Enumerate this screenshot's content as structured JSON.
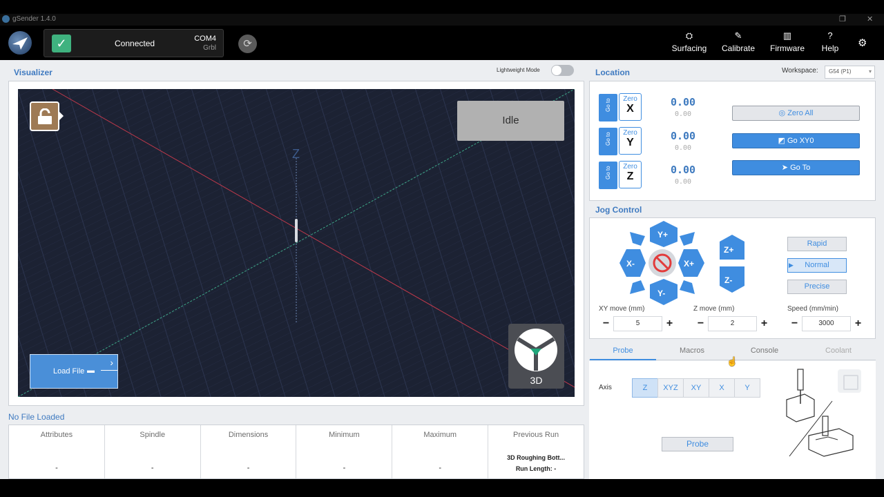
{
  "window": {
    "title": "gSender 1.4.0",
    "restore_glyph": "❐",
    "close_glyph": "✕"
  },
  "connection": {
    "status": "Connected",
    "port": "COM4",
    "firmware": "Grbl"
  },
  "nav": [
    {
      "label": "Surfacing",
      "icon": "surfacing-icon",
      "glyph": "⛭"
    },
    {
      "label": "Calibrate",
      "icon": "calibrate-icon",
      "glyph": "✎"
    },
    {
      "label": "Firmware",
      "icon": "firmware-icon",
      "glyph": "▥"
    },
    {
      "label": "Help",
      "icon": "help-icon",
      "glyph": "?"
    }
  ],
  "visualizer": {
    "title": "Visualizer",
    "lightweight_label": "Lightweight Mode",
    "lightweight_on": false,
    "state": "Idle",
    "axis_label": "Z",
    "load_file_label": "Load File",
    "view_label": "3D"
  },
  "file_info": {
    "title": "No File Loaded",
    "columns": [
      {
        "header": "Attributes",
        "value": "-"
      },
      {
        "header": "Spindle",
        "value": "-"
      },
      {
        "header": "Dimensions",
        "value": "-"
      },
      {
        "header": "Minimum",
        "value": "-"
      },
      {
        "header": "Maximum",
        "value": "-"
      },
      {
        "header": "Previous Run",
        "line1": "3D Roughing Bott...",
        "line2": "Run Length: -"
      }
    ]
  },
  "location": {
    "title": "Location",
    "workspace_label": "Workspace:",
    "workspace_value": "G54 (P1)",
    "goto_label": "Go to",
    "zero_label": "Zero",
    "axes": [
      {
        "axis": "X",
        "value": "0.00",
        "sub": "0.00"
      },
      {
        "axis": "Y",
        "value": "0.00",
        "sub": "0.00"
      },
      {
        "axis": "Z",
        "value": "0.00",
        "sub": "0.00"
      }
    ],
    "zero_all_label": "Zero All",
    "go_xy0_label": "Go XY0",
    "go_to_label": "Go To"
  },
  "jog": {
    "title": "Jog Control",
    "dirs": {
      "yplus": "Y+",
      "yminus": "Y-",
      "xplus": "X+",
      "xminus": "X-",
      "zplus": "Z+",
      "zminus": "Z-"
    },
    "speeds": [
      "Rapid",
      "Normal",
      "Precise"
    ],
    "active_speed": "Normal",
    "xy_label": "XY move (mm)",
    "xy_value": "5",
    "z_label": "Z move (mm)",
    "z_value": "2",
    "speed_label": "Speed (mm/min)",
    "speed_value": "3000",
    "minus": "−",
    "plus": "+"
  },
  "tabs": [
    "Probe",
    "Macros",
    "Console",
    "Coolant"
  ],
  "active_tab": "Probe",
  "probe": {
    "axis_label": "Axis",
    "axes": [
      "Z",
      "XYZ",
      "XY",
      "X",
      "Y"
    ],
    "active_axis": "Z",
    "button": "Probe"
  },
  "colors": {
    "accent": "#3f8de0",
    "connected": "#3fb27f",
    "canvas": "#1c2233",
    "lock": "#9e7a55"
  }
}
